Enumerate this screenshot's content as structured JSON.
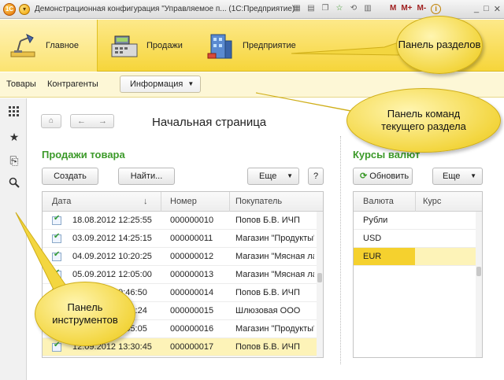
{
  "titlebar": {
    "title": "Демонстрационная конфигурация \"Управляемое п... (1С:Предприятие)",
    "logo": "1С",
    "right_buttons": [
      "M",
      "M+",
      "M-"
    ],
    "info": "i"
  },
  "sections": {
    "items": [
      {
        "label": "Главное",
        "icon": "desk-lamp-icon",
        "active": true
      },
      {
        "label": "Продажи",
        "icon": "cash-register-icon",
        "active": false
      },
      {
        "label": "Предприятие",
        "icon": "building-icon",
        "active": false
      }
    ]
  },
  "commands": {
    "items": [
      "Товары",
      "Контрагенты"
    ],
    "dropdown": "Информация"
  },
  "nav": {
    "page_title": "Начальная страница"
  },
  "sales": {
    "title": "Продажи товара",
    "create": "Создать",
    "find": "Найти...",
    "more": "Еще",
    "help": "?",
    "columns": [
      "Дата",
      "Номер",
      "Покупатель"
    ],
    "sort_icon": "↓",
    "rows": [
      {
        "date": "18.08.2012 12:25:55",
        "number": "000000010",
        "buyer": "Попов Б.В. ИЧП"
      },
      {
        "date": "03.09.2012 14:25:15",
        "number": "000000011",
        "buyer": "Магазин \"Продукты\""
      },
      {
        "date": "04.09.2012 10:20:25",
        "number": "000000012",
        "buyer": "Магазин \"Мясная ла"
      },
      {
        "date": "05.09.2012 12:05:00",
        "number": "000000013",
        "buyer": "Магазин \"Мясная ла"
      },
      {
        "date": "06.09.2012 9:46:50",
        "number": "000000014",
        "buyer": "Попов Б.В. ИЧП"
      },
      {
        "date": "07.09.2012 9:30:24",
        "number": "000000015",
        "buyer": "Шлюзовая ООО"
      },
      {
        "date": "10.09.2012 9:55:05",
        "number": "000000016",
        "buyer": "Магазин \"Продукты\""
      },
      {
        "date": "12.09.2012 13:30:45",
        "number": "000000017",
        "buyer": "Попов Б.В. ИЧП"
      }
    ]
  },
  "rates": {
    "title": "Курсы валют",
    "refresh": "Обновить",
    "more": "Еще",
    "columns": [
      "Валюта",
      "Курс"
    ],
    "rows": [
      {
        "currency": "Рубли",
        "rate": ""
      },
      {
        "currency": "USD",
        "rate": ""
      },
      {
        "currency": "EUR",
        "rate": ""
      }
    ]
  },
  "callouts": {
    "sections": "Панель разделов",
    "commands": "Панель команд текущего раздела",
    "tools": "Панель инструментов"
  },
  "colors": {
    "sections_bg": "#f6d53a",
    "accent_green": "#3c9a2a",
    "selected_row": "#fdf3b8",
    "eur_highlight": "#f5d12e"
  }
}
